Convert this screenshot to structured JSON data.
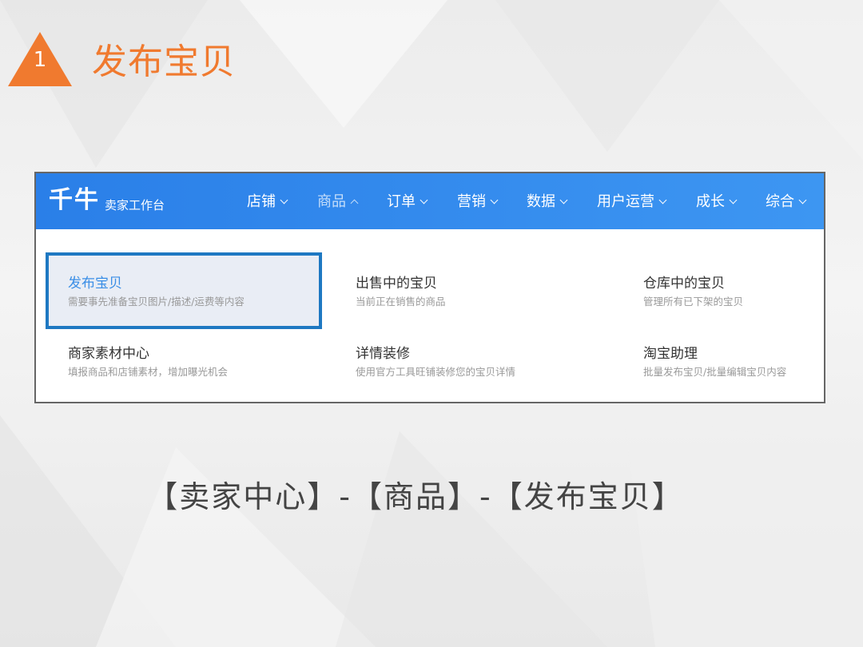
{
  "step": {
    "number": "1",
    "title": "发布宝贝",
    "accent_color": "#f07a2f"
  },
  "app": {
    "logo_text": "千牛",
    "subtitle": "卖家工作台",
    "nav_color": "#2a7fe8"
  },
  "nav": {
    "items": [
      {
        "label": "店铺",
        "icon": "chevron-down-icon",
        "active": false
      },
      {
        "label": "商品",
        "icon": "chevron-up-icon",
        "active": true
      },
      {
        "label": "订单",
        "icon": "chevron-down-icon",
        "active": false
      },
      {
        "label": "营销",
        "icon": "chevron-down-icon",
        "active": false
      },
      {
        "label": "数据",
        "icon": "chevron-down-icon",
        "active": false
      },
      {
        "label": "用户运营",
        "icon": "chevron-down-icon",
        "active": false
      },
      {
        "label": "成长",
        "icon": "chevron-down-icon",
        "active": false
      },
      {
        "label": "综合",
        "icon": "chevron-down-icon",
        "active": false
      }
    ]
  },
  "menu": {
    "items": [
      {
        "title": "发布宝贝",
        "desc": "需要事先准备宝贝图片/描述/运费等内容",
        "highlighted": true
      },
      {
        "title": "出售中的宝贝",
        "desc": "当前正在销售的商品",
        "highlighted": false
      },
      {
        "title": "仓库中的宝贝",
        "desc": "管理所有已下架的宝贝",
        "highlighted": false
      },
      {
        "title": "商家素材中心",
        "desc": "填报商品和店铺素材，增加曝光机会",
        "highlighted": false
      },
      {
        "title": "详情装修",
        "desc": "使用官方工具旺铺装修您的宝贝详情",
        "highlighted": false
      },
      {
        "title": "淘宝助理",
        "desc": "批量发布宝贝/批量编辑宝贝内容",
        "highlighted": false
      }
    ],
    "highlight_color": "#1e78c2"
  },
  "breadcrumb": "【卖家中心】-【商品】-【发布宝贝】"
}
